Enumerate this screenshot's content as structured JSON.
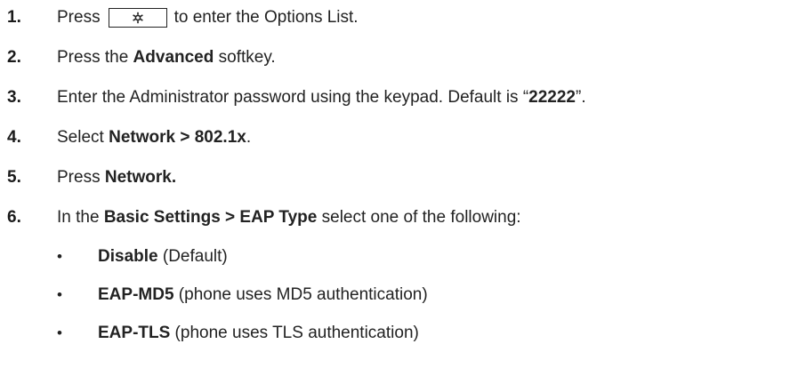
{
  "steps": [
    {
      "num": "1.",
      "pre": "Press",
      "post": "to enter the Options List."
    },
    {
      "num": "2.",
      "pre": "Press the ",
      "bold": "Advanced",
      "post": " softkey."
    },
    {
      "num": "3.",
      "pre": "Enter the Administrator password using the keypad. Default is “",
      "bold": "22222",
      "post": "”."
    },
    {
      "num": "4.",
      "pre": "Select ",
      "bold": "Network > 802.1x",
      "post": "."
    },
    {
      "num": "5.",
      "pre": "Press ",
      "bold": "Network."
    },
    {
      "num": "6.",
      "pre": "In the ",
      "bold": "Basic Settings > EAP Type",
      "post": " select one of the following:"
    }
  ],
  "options": [
    {
      "bullet": "•",
      "bold": "Disable",
      "post": " (Default)"
    },
    {
      "bullet": "•",
      "bold": "EAP-MD5",
      "post": " (phone uses MD5 authentication)"
    },
    {
      "bullet": "•",
      "bold": "EAP-TLS",
      "post": " (phone uses TLS authentication)"
    }
  ],
  "key_icon": "gear-options-icon",
  "text_color": "#222222"
}
